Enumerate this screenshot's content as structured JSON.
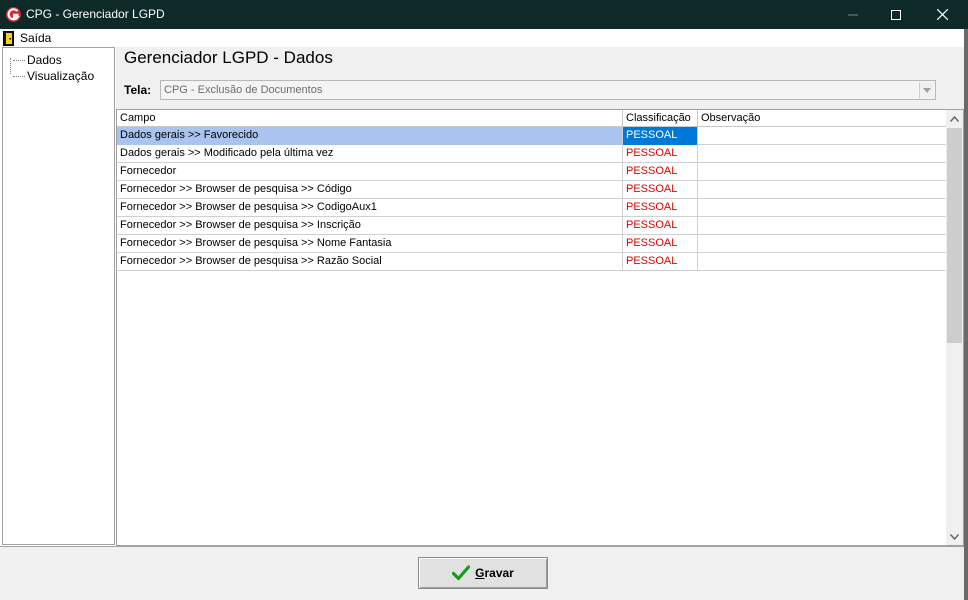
{
  "window": {
    "title": "CPG - Gerenciador LGPD"
  },
  "menu": {
    "exit_label": "Saída"
  },
  "tree": {
    "items": [
      {
        "label": "Dados"
      },
      {
        "label": "Visualização"
      }
    ]
  },
  "main": {
    "title": "Gerenciador LGPD - Dados",
    "tela_label": "Tela:",
    "tela_value": "CPG - Exclusão de Documentos"
  },
  "grid": {
    "columns": [
      "Campo",
      "Classificação",
      "Observação"
    ],
    "rows": [
      {
        "campo": "Dados gerais >> Favorecido",
        "classificacao": "PESSOAL",
        "observacao": "",
        "selected": true
      },
      {
        "campo": "Dados gerais >> Modificado pela última vez",
        "classificacao": "PESSOAL",
        "observacao": ""
      },
      {
        "campo": "Fornecedor",
        "classificacao": "PESSOAL",
        "observacao": ""
      },
      {
        "campo": "Fornecedor >> Browser de pesquisa >> Código",
        "classificacao": "PESSOAL",
        "observacao": ""
      },
      {
        "campo": "Fornecedor >> Browser de pesquisa >> CodigoAux1",
        "classificacao": "PESSOAL",
        "observacao": ""
      },
      {
        "campo": "Fornecedor >> Browser de pesquisa >> Inscrição",
        "classificacao": "PESSOAL",
        "observacao": ""
      },
      {
        "campo": "Fornecedor >> Browser de pesquisa >> Nome Fantasia",
        "classificacao": "PESSOAL",
        "observacao": ""
      },
      {
        "campo": "Fornecedor >> Browser de pesquisa >> Razão Social",
        "classificacao": "PESSOAL",
        "observacao": ""
      }
    ]
  },
  "footer": {
    "save_label_first": "G",
    "save_label_rest": "ravar"
  },
  "colors": {
    "titlebar": "#0d2a28",
    "selected_row": "#a9c4ee",
    "selected_cell": "#0078d7",
    "classification_text": "#e00000",
    "save_check": "#1a9a1a"
  }
}
